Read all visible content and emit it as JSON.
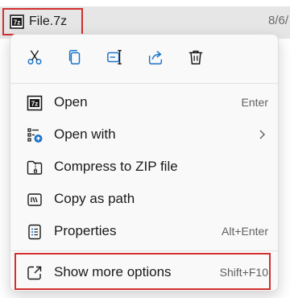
{
  "file": {
    "name": "File.7z",
    "date": "8/6/",
    "icon": "7z-archive-icon"
  },
  "quick_actions": [
    {
      "name": "cut",
      "icon": "scissors-icon"
    },
    {
      "name": "copy",
      "icon": "copy-icon"
    },
    {
      "name": "rename",
      "icon": "rename-icon"
    },
    {
      "name": "share",
      "icon": "share-icon"
    },
    {
      "name": "delete",
      "icon": "trash-icon"
    }
  ],
  "menu": {
    "items": [
      {
        "label": "Open",
        "shortcut": "Enter",
        "icon": "7z-archive-icon"
      },
      {
        "label": "Open with",
        "shortcut": "",
        "icon": "open-with-icon",
        "has_submenu": true
      },
      {
        "label": "Compress to ZIP file",
        "shortcut": "",
        "icon": "zip-folder-icon"
      },
      {
        "label": "Copy as path",
        "shortcut": "",
        "icon": "copy-path-icon"
      },
      {
        "label": "Properties",
        "shortcut": "Alt+Enter",
        "icon": "properties-icon"
      },
      {
        "label": "Show more options",
        "shortcut": "Shift+F10",
        "icon": "show-more-icon"
      }
    ]
  },
  "colors": {
    "accent": "#1a73c9",
    "highlight_border": "#d32f2f",
    "menu_bg": "#f9f9f9",
    "row_bg": "#e6e6e6"
  }
}
